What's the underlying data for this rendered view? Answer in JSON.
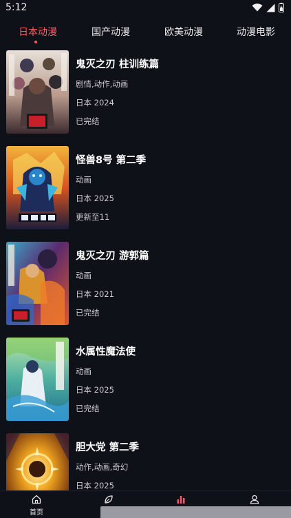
{
  "status_bar": {
    "time": "5:12",
    "icons": [
      "wifi-icon",
      "signal-icon",
      "battery-icon"
    ]
  },
  "tabs": [
    {
      "label": "日本动漫",
      "active": true
    },
    {
      "label": "国产动漫",
      "active": false
    },
    {
      "label": "欧美动漫",
      "active": false
    },
    {
      "label": "动漫电影",
      "active": false
    }
  ],
  "items": [
    {
      "title": "鬼灭之刃 柱训练篇",
      "genre": "剧情,动作,动画",
      "region_year": "日本 2024",
      "status": "已完结"
    },
    {
      "title": "怪兽8号 第二季",
      "genre": "动画",
      "region_year": "日本 2025",
      "status": "更新至11"
    },
    {
      "title": "鬼灭之刃 游郭篇",
      "genre": "动画",
      "region_year": "日本 2021",
      "status": "已完结"
    },
    {
      "title": "水属性魔法使",
      "genre": "动画",
      "region_year": "日本 2025",
      "status": "已完结"
    },
    {
      "title": "胆大党 第二季",
      "genre": "动作,动画,奇幻",
      "region_year": "日本 2025",
      "status": ""
    }
  ],
  "bottom_nav": [
    {
      "label": "首页",
      "icon": "home-icon"
    },
    {
      "label": "",
      "icon": "leaf-icon"
    },
    {
      "label": "",
      "icon": "ranking-icon"
    },
    {
      "label": "",
      "icon": "profile-icon"
    }
  ],
  "colors": {
    "background": "#0f1119",
    "accent": "#f25c64",
    "text_primary": "#ffffff",
    "text_secondary": "#c9c9cf"
  }
}
